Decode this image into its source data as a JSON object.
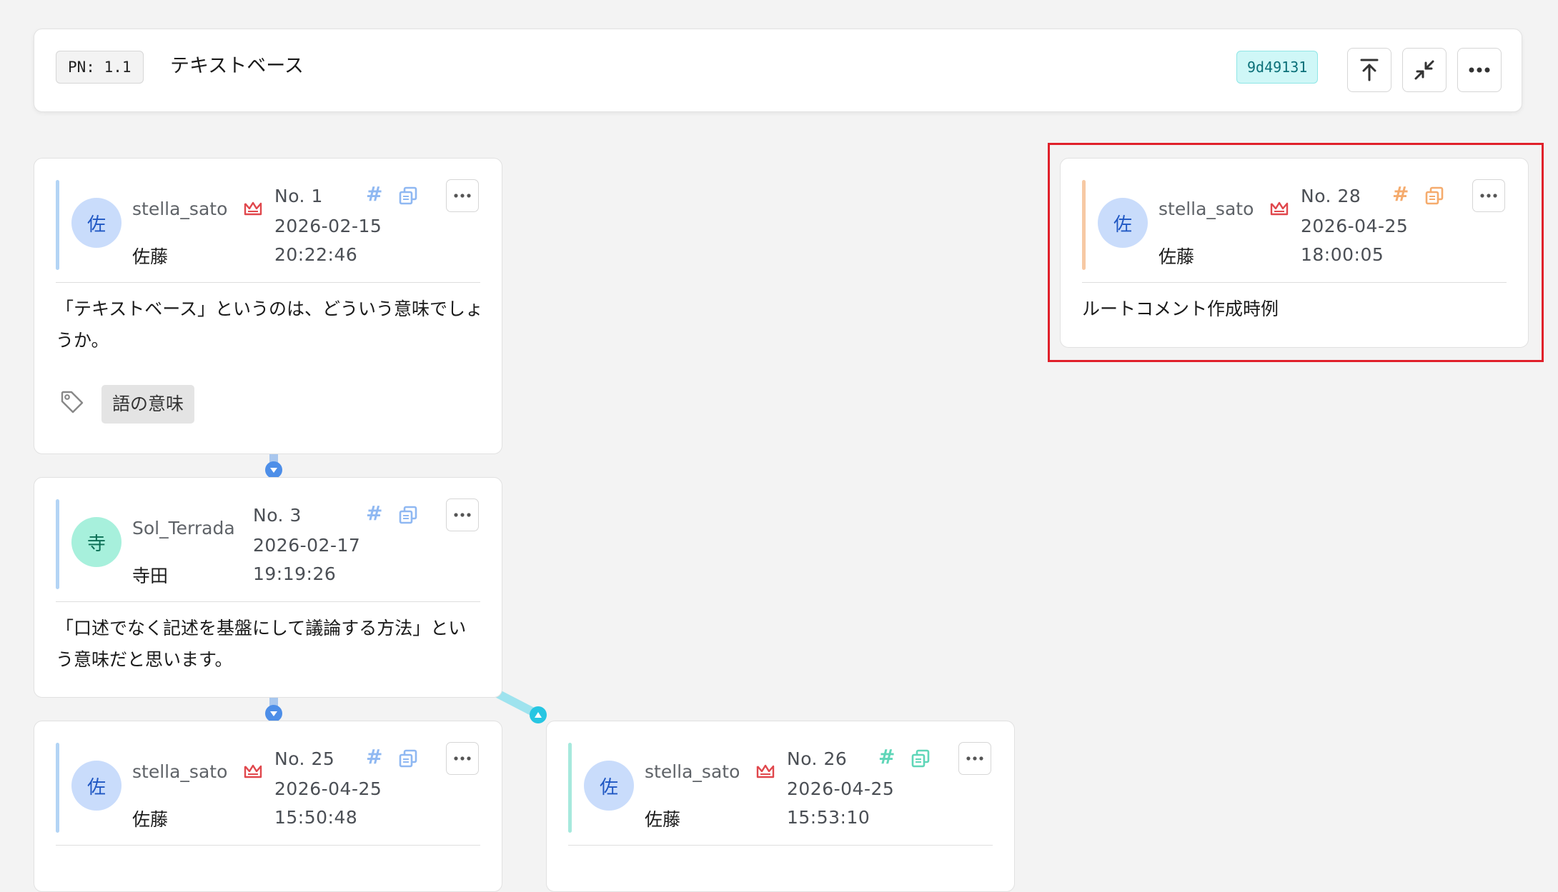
{
  "header": {
    "pn_label": "PN: 1.1",
    "title": "テキストベース",
    "commit_hash": "9d49131",
    "colors": {
      "hash_bg": "#cff7f7",
      "hash_text": "#0a6f78"
    }
  },
  "comments": [
    {
      "id": "c1",
      "username": "stella_sato",
      "display_name": "佐藤",
      "avatar_char": "佐",
      "number": "No. 1",
      "date": "2026-02-15",
      "time": "20:22:46",
      "body": [
        "「テキストベース」というのは、どういう意味でしょ",
        "うか。"
      ],
      "tag": "語の意味",
      "accent": "#b3d4f5"
    },
    {
      "id": "c3",
      "username": "Sol_Terrada",
      "display_name": "寺田",
      "avatar_char": "寺",
      "number": "No. 3",
      "date": "2026-02-17",
      "time": "19:19:26",
      "body": [
        "「口述でなく記述を基盤にして議論する方法」とい",
        "う意味だと思います。"
      ],
      "accent": "#b3d4f5"
    },
    {
      "id": "c25",
      "username": "stella_sato",
      "display_name": "佐藤",
      "avatar_char": "佐",
      "number": "No. 25",
      "date": "2026-04-25",
      "time": "15:50:48",
      "accent": "#b3d4f5"
    },
    {
      "id": "c26",
      "username": "stella_sato",
      "display_name": "佐藤",
      "avatar_char": "佐",
      "number": "No. 26",
      "date": "2026-04-25",
      "time": "15:53:10",
      "accent": "#a6e9dd"
    },
    {
      "id": "c28",
      "username": "stella_sato",
      "display_name": "佐藤",
      "avatar_char": "佐",
      "number": "No. 28",
      "date": "2026-04-25",
      "time": "18:00:05",
      "body": [
        "ルートコメント作成時例"
      ],
      "accent": "#f7c9a4"
    }
  ],
  "icons": {
    "avatar_sato_bg": "#c9dcfb",
    "avatar_sato_fg": "#1f57c3",
    "avatar_terada_bg": "#a7f0dc",
    "avatar_terada_fg": "#0b6f55",
    "crown": "#e0474c",
    "blue_tool": "#8fb8f2",
    "teal_tool": "#5fd6b8",
    "orange_tool": "#f5ab6d"
  }
}
